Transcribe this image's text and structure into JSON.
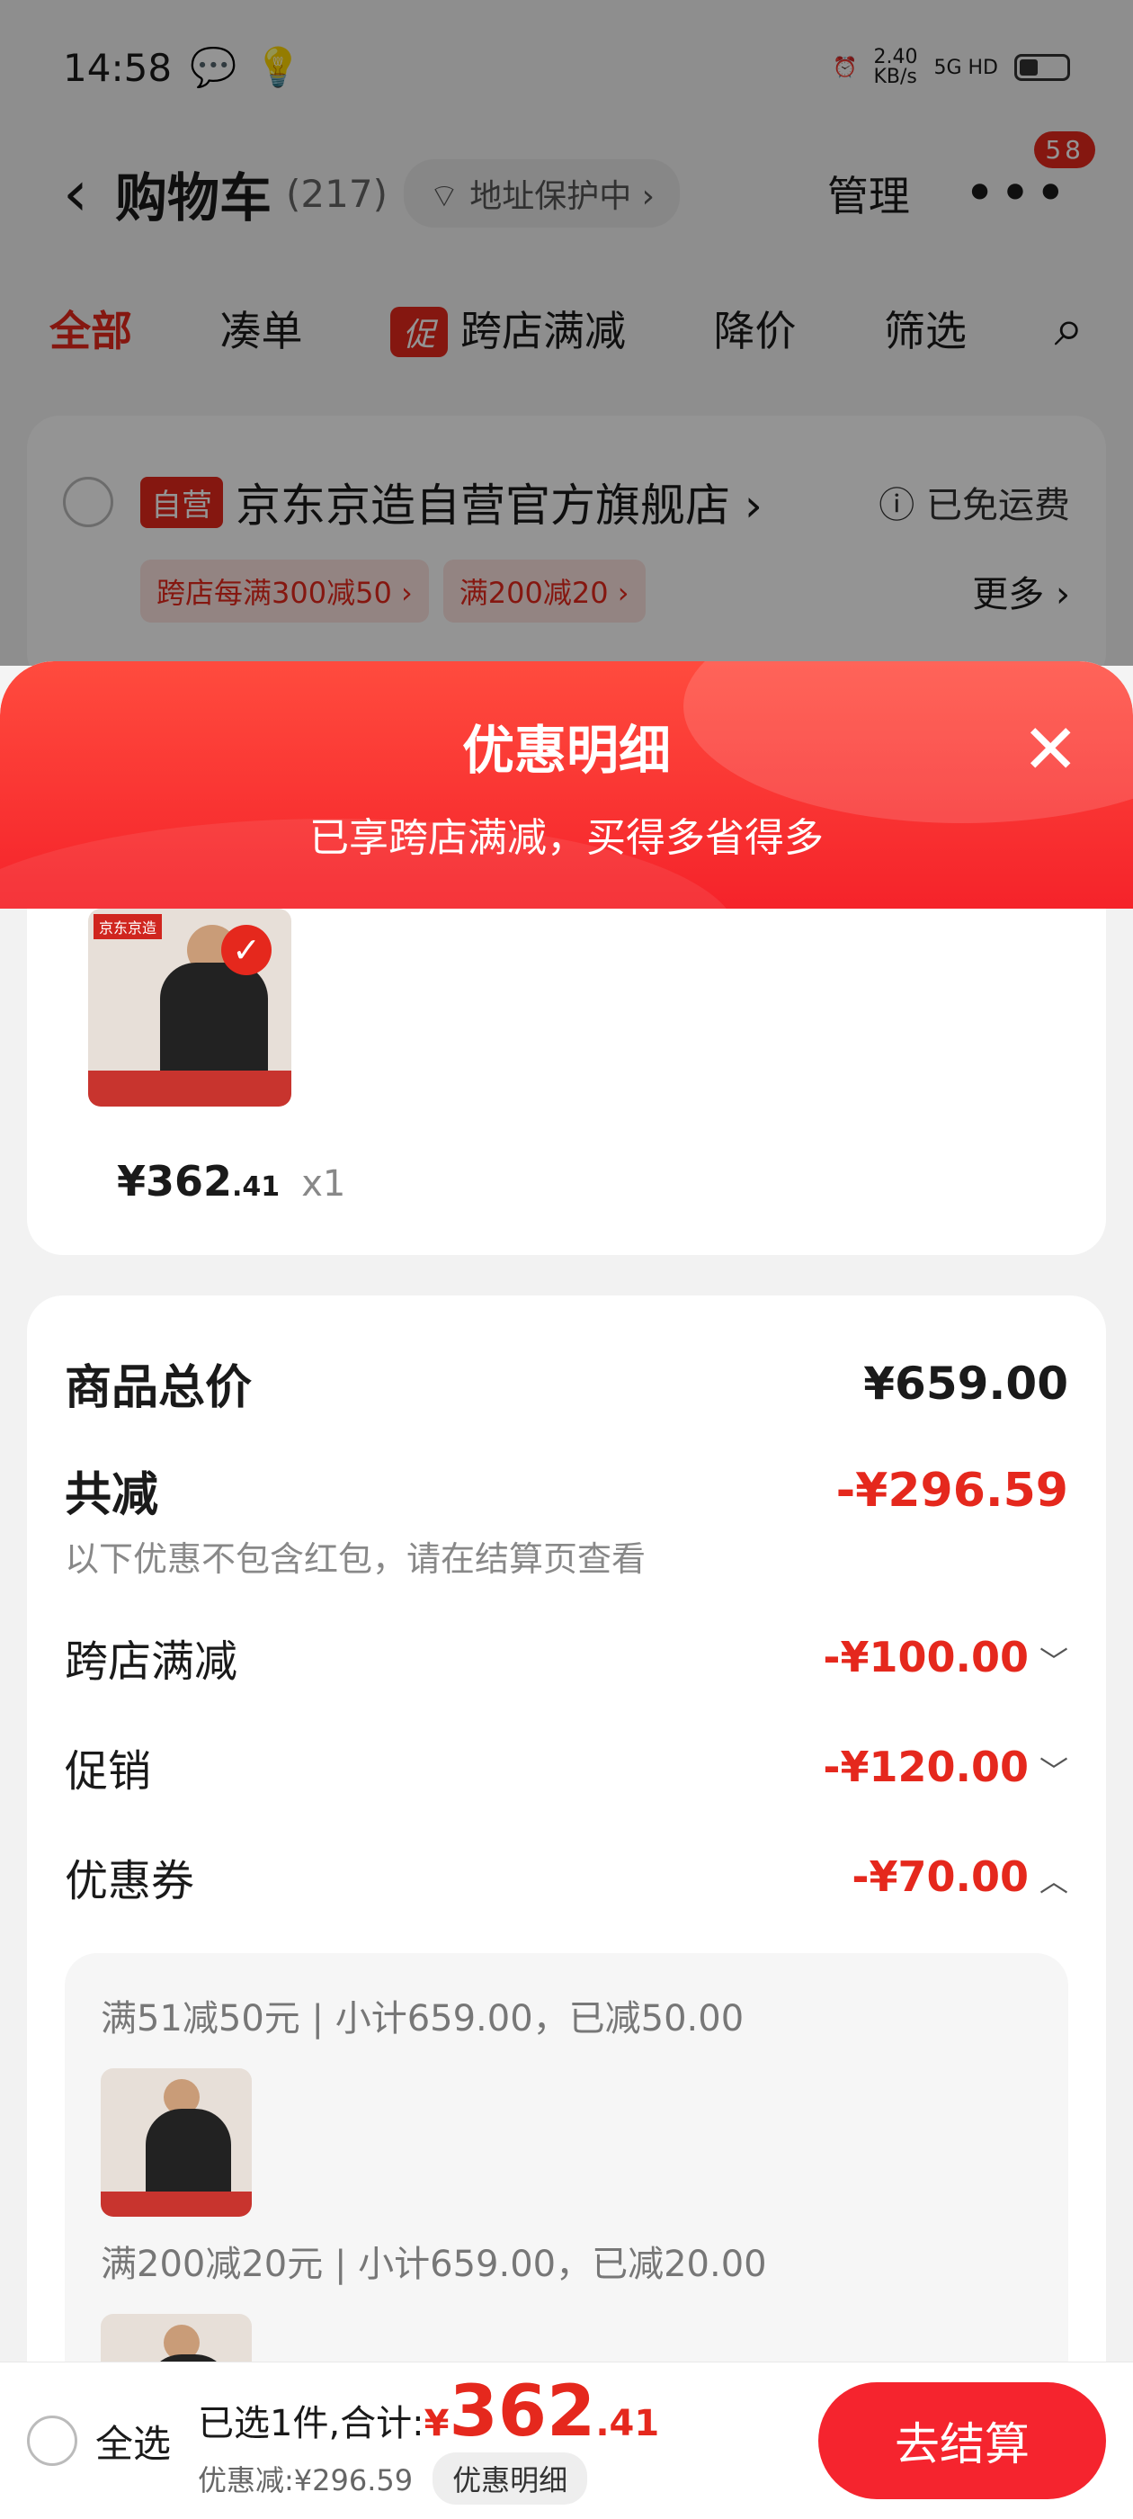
{
  "status": {
    "time": "14:58",
    "net_speed": "2.40\nKB/s",
    "net_label": "5G HD"
  },
  "nav": {
    "back": "‹",
    "title": "购物车",
    "count": "(217)",
    "address_pill": "⌔ 地址保护中 ›",
    "manage": "管理",
    "more": "•••",
    "badge": "58"
  },
  "tabs": {
    "all": "全部",
    "bundle": "凑单",
    "promo_chip": "促",
    "cross_store": "跨店满减",
    "price_drop": "降价",
    "filter": "筛选",
    "search_icon": "⌕"
  },
  "store": {
    "tag": "自营",
    "name": "京东京造自营官方旗舰店 ›",
    "shipping": "ⓘ 已免运费",
    "coupons": [
      "跨店每满300减50 ›",
      "满200减20 ›"
    ],
    "more": "更多 ›"
  },
  "sheet": {
    "title": "优惠明细",
    "subtitle": "已享跨店满减，买得多省得多",
    "close": "✕",
    "item": {
      "thumb_logo": "京东京造",
      "check": "✓",
      "price_int": "¥362",
      "price_dec": ".41",
      "qty": "x1"
    },
    "summary": {
      "total_label": "商品总价",
      "total_value": "¥659.00",
      "reduce_label": "共减",
      "reduce_value": "-¥296.59",
      "note": "以下优惠不包含红包，请在结算页查看",
      "rows": [
        {
          "label": "跨店满减",
          "value": "-¥100.00",
          "chev": "﹀"
        },
        {
          "label": "促销",
          "value": "-¥120.00",
          "chev": "﹀"
        },
        {
          "label": "优惠券",
          "value": "-¥70.00",
          "chev": "︿"
        }
      ],
      "coupon_details": [
        "满51减50元 | 小计659.00，已减50.00",
        "满200减20元 | 小计659.00，已减20.00"
      ]
    }
  },
  "bottom": {
    "select_all": "全选",
    "selected_text": "已选1件,合计:",
    "yen": "¥",
    "total_int": "362",
    "total_dec": ".41",
    "discount_text": "优惠减:¥296.59",
    "detail_chip": "优惠明细",
    "checkout": "去结算"
  },
  "colors": {
    "accent": "#e5281d",
    "sheet_head": "#f5232a"
  }
}
